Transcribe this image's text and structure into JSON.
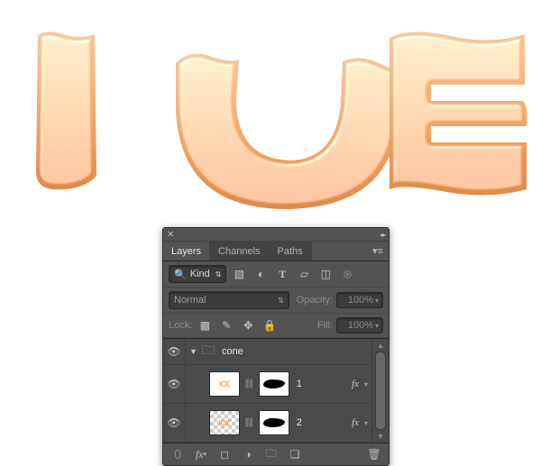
{
  "tabs": {
    "layers": "Layers",
    "channels": "Channels",
    "paths": "Paths"
  },
  "filter": {
    "mode": "Kind"
  },
  "blend": {
    "mode": "Normal",
    "opacity_label": "Opacity:",
    "opacity_value": "100%"
  },
  "lock": {
    "label": "Lock:",
    "fill_label": "Fill:",
    "fill_value": "100%"
  },
  "group": {
    "name": "cone"
  },
  "layers": [
    {
      "name": "1"
    },
    {
      "name": "2"
    }
  ]
}
